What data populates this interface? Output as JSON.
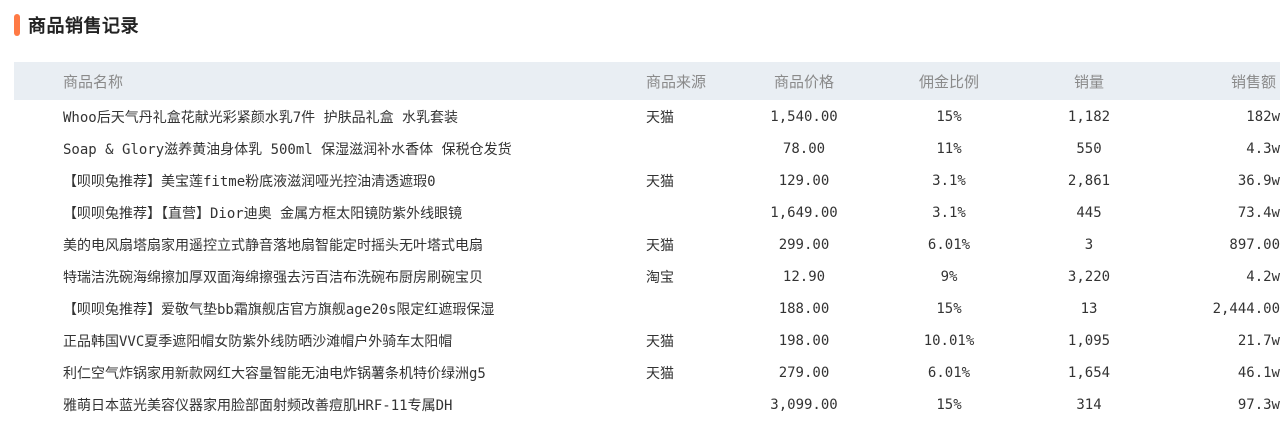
{
  "header": {
    "title": "商品销售记录",
    "accent_color": "#ff7a45"
  },
  "table": {
    "columns": [
      "商品名称",
      "商品来源",
      "商品价格",
      "佣金比例",
      "销量",
      "销售额"
    ],
    "rows": [
      {
        "name": "Whoo后天气丹礼盒花献光彩紧颜水乳7件 护肤品礼盒 水乳套装",
        "source": "天猫",
        "price": "1,540.00",
        "commission": "15%",
        "sales": "1,182",
        "revenue": "182w"
      },
      {
        "name": "Soap & Glory滋养黄油身体乳 500ml 保湿滋润补水香体 保税仓发货",
        "source": "",
        "price": "78.00",
        "commission": "11%",
        "sales": "550",
        "revenue": "4.3w"
      },
      {
        "name": "【呗呗兔推荐】美宝莲fitme粉底液滋润哑光控油清透遮瑕0",
        "source": "天猫",
        "price": "129.00",
        "commission": "3.1%",
        "sales": "2,861",
        "revenue": "36.9w"
      },
      {
        "name": "【呗呗兔推荐】【直营】Dior迪奥 金属方框太阳镜防紫外线眼镜",
        "source": "",
        "price": "1,649.00",
        "commission": "3.1%",
        "sales": "445",
        "revenue": "73.4w"
      },
      {
        "name": "美的电风扇塔扇家用遥控立式静音落地扇智能定时摇头无叶塔式电扇",
        "source": "天猫",
        "price": "299.00",
        "commission": "6.01%",
        "sales": "3",
        "revenue": "897.00"
      },
      {
        "name": "特瑞洁洗碗海绵擦加厚双面海绵擦强去污百洁布洗碗布厨房刷碗宝贝",
        "source": "淘宝",
        "price": "12.90",
        "commission": "9%",
        "sales": "3,220",
        "revenue": "4.2w"
      },
      {
        "name": "【呗呗兔推荐】爱敬气垫bb霜旗舰店官方旗舰age20s限定红遮瑕保湿",
        "source": "",
        "price": "188.00",
        "commission": "15%",
        "sales": "13",
        "revenue": "2,444.00"
      },
      {
        "name": "正品韩国VVC夏季遮阳帽女防紫外线防晒沙滩帽户外骑车太阳帽",
        "source": "天猫",
        "price": "198.00",
        "commission": "10.01%",
        "sales": "1,095",
        "revenue": "21.7w"
      },
      {
        "name": "利仁空气炸锅家用新款网红大容量智能无油电炸锅薯条机特价绿洲g5",
        "source": "天猫",
        "price": "279.00",
        "commission": "6.01%",
        "sales": "1,654",
        "revenue": "46.1w"
      },
      {
        "name": "雅萌日本蓝光美容仪器家用脸部面射频改善痘肌HRF-11专属DH",
        "source": "",
        "price": "3,099.00",
        "commission": "15%",
        "sales": "314",
        "revenue": "97.3w"
      }
    ]
  }
}
